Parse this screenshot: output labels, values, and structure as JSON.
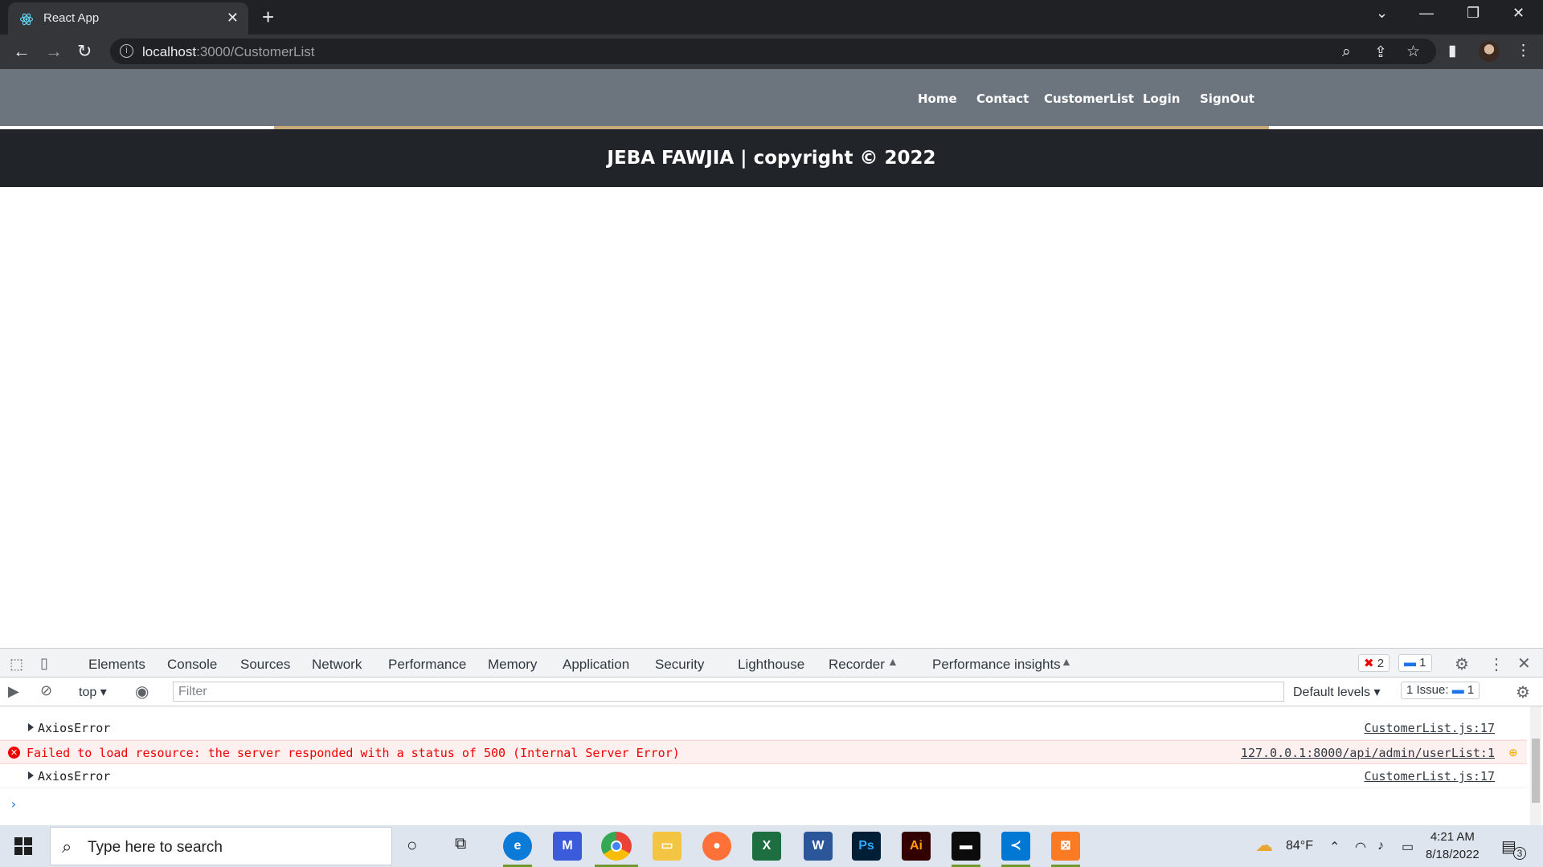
{
  "browser": {
    "tab_title": "React App",
    "url_host": "localhost",
    "url_rest": ":3000/CustomerList"
  },
  "page": {
    "nav_links": [
      "Home",
      "Contact",
      "CustomerList",
      "Login",
      "SignOut"
    ],
    "footer_text": "JEBA FAWJIA | copyright © 2022"
  },
  "devtools": {
    "tabs": [
      "Elements",
      "Console",
      "Sources",
      "Network",
      "Performance",
      "Memory",
      "Application",
      "Security",
      "Lighthouse",
      "Recorder",
      "Performance insights"
    ],
    "active_tab": "Console",
    "error_count": "2",
    "message_count": "1",
    "context": "top",
    "filter_placeholder": "Filter",
    "levels": "Default levels",
    "issues_label": "1 Issue:",
    "issues_count": "1",
    "rows": [
      {
        "type": "object",
        "text": "AxiosError",
        "source": "CustomerList.js:17"
      },
      {
        "type": "error",
        "text": "Failed to load resource: the server responded with a status of 500 (Internal Server Error)",
        "source": "127.0.0.1:8000/api/admin/userList:1"
      },
      {
        "type": "object",
        "text": "AxiosError",
        "source": "CustomerList.js:17"
      }
    ]
  },
  "taskbar": {
    "search_placeholder": "Type here to search",
    "weather": "84°F",
    "time": "4:21 AM",
    "date": "8/18/2022",
    "notification_count": "3"
  }
}
